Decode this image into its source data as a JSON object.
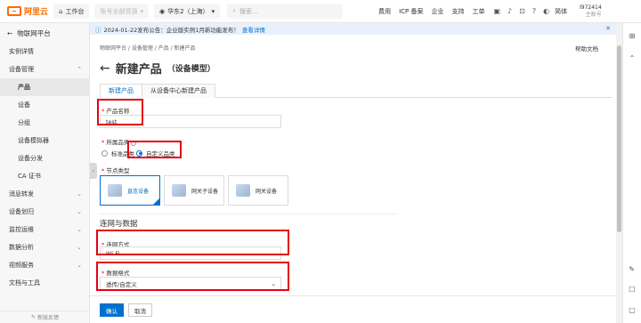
{
  "topbar": {
    "logo": "阿里云",
    "workbench": "工作台",
    "account": "账号全部资源",
    "region": "华东2（上海）",
    "search_placeholder": "搜索...",
    "links": [
      "费用",
      "ICP 备案",
      "企业",
      "支持",
      "工单"
    ],
    "lang": "简体",
    "user_name": "l972414",
    "user_sub": "主账号"
  },
  "sidebar": {
    "header": "物联网平台",
    "items": [
      {
        "label": "实例详情",
        "type": "top"
      },
      {
        "label": "设备管理",
        "type": "group",
        "expanded": true
      },
      {
        "label": "产品",
        "type": "sub",
        "active": true
      },
      {
        "label": "设备",
        "type": "sub"
      },
      {
        "label": "分组",
        "type": "sub"
      },
      {
        "label": "设备模拟器",
        "type": "sub"
      },
      {
        "label": "设备分发",
        "type": "sub"
      },
      {
        "label": "CA 证书",
        "type": "sub"
      },
      {
        "label": "消息转发",
        "type": "group"
      },
      {
        "label": "设备划归",
        "type": "group"
      },
      {
        "label": "监控运维",
        "type": "group"
      },
      {
        "label": "数据分析",
        "type": "group"
      },
      {
        "label": "视频服务",
        "type": "group"
      },
      {
        "label": "文档与工具",
        "type": "top"
      }
    ],
    "footer": "新版反馈"
  },
  "notice": {
    "text": "2024-01-22发布公告：企业版实例1月新功能发布！",
    "link": "查看详情"
  },
  "main": {
    "breadcrumb": "物联网平台 / 设备管理 / 产品 / 新建产品",
    "help": "帮助文档",
    "title": "新建产品",
    "subtitle": "（设备模型）",
    "tabs": [
      "新建产品",
      "从设备中心新建产品"
    ],
    "product_name_label": "产品名称",
    "product_name_value": "test",
    "category_label": "所属品类",
    "category_options": [
      "标准品类",
      "自定义品类"
    ],
    "category_selected": 1,
    "node_type_label": "节点类型",
    "node_types": [
      "直连设备",
      "网关子设备",
      "网关设备"
    ],
    "node_type_selected": 0,
    "section_title": "连网与数据",
    "network_label": "连网方式",
    "network_value": "Wi-Fi",
    "data_format_label": "数据格式",
    "data_format_value": "透传/自定义"
  },
  "footer": {
    "confirm": "确认",
    "cancel": "取消"
  },
  "colors": {
    "accent": "#0070cc",
    "brand": "#ff6a00",
    "highlight": "#e60012"
  }
}
